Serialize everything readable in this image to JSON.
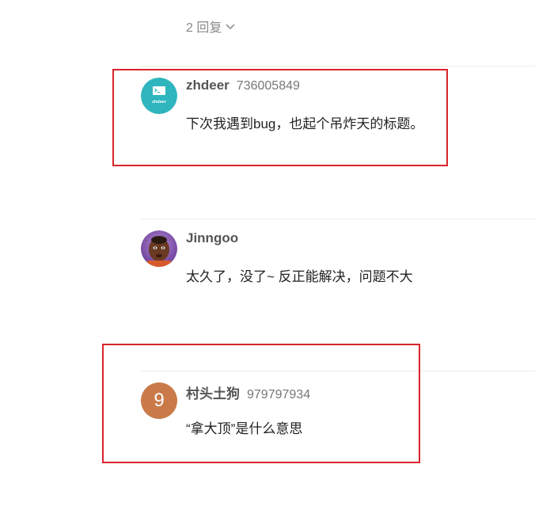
{
  "replies": {
    "toggle_label": "2 回复",
    "toggle_icon": "chevron-down-icon"
  },
  "comments": [
    {
      "author": "zhdeer",
      "uid": "736005849",
      "content": "下次我遇到bug，也起个吊炸天的标题。",
      "avatar": {
        "type": "logo",
        "text": "zhdeer",
        "color": "#2fb5bd"
      },
      "highlighted": true
    },
    {
      "author": "Jinngoo",
      "uid": "",
      "content": "太久了，没了~ 反正能解决，问题不大",
      "avatar": {
        "type": "photo"
      },
      "highlighted": false
    },
    {
      "author": "村头土狗",
      "uid": "979797934",
      "content": "“拿大顶”是什么意思",
      "avatar": {
        "type": "letter",
        "text": "9",
        "color": "#c97a48"
      },
      "highlighted": true
    }
  ],
  "colors": {
    "highlight_border": "#d9232b",
    "divider": "#ececec",
    "author_text": "#555555",
    "body_text": "#222222"
  }
}
